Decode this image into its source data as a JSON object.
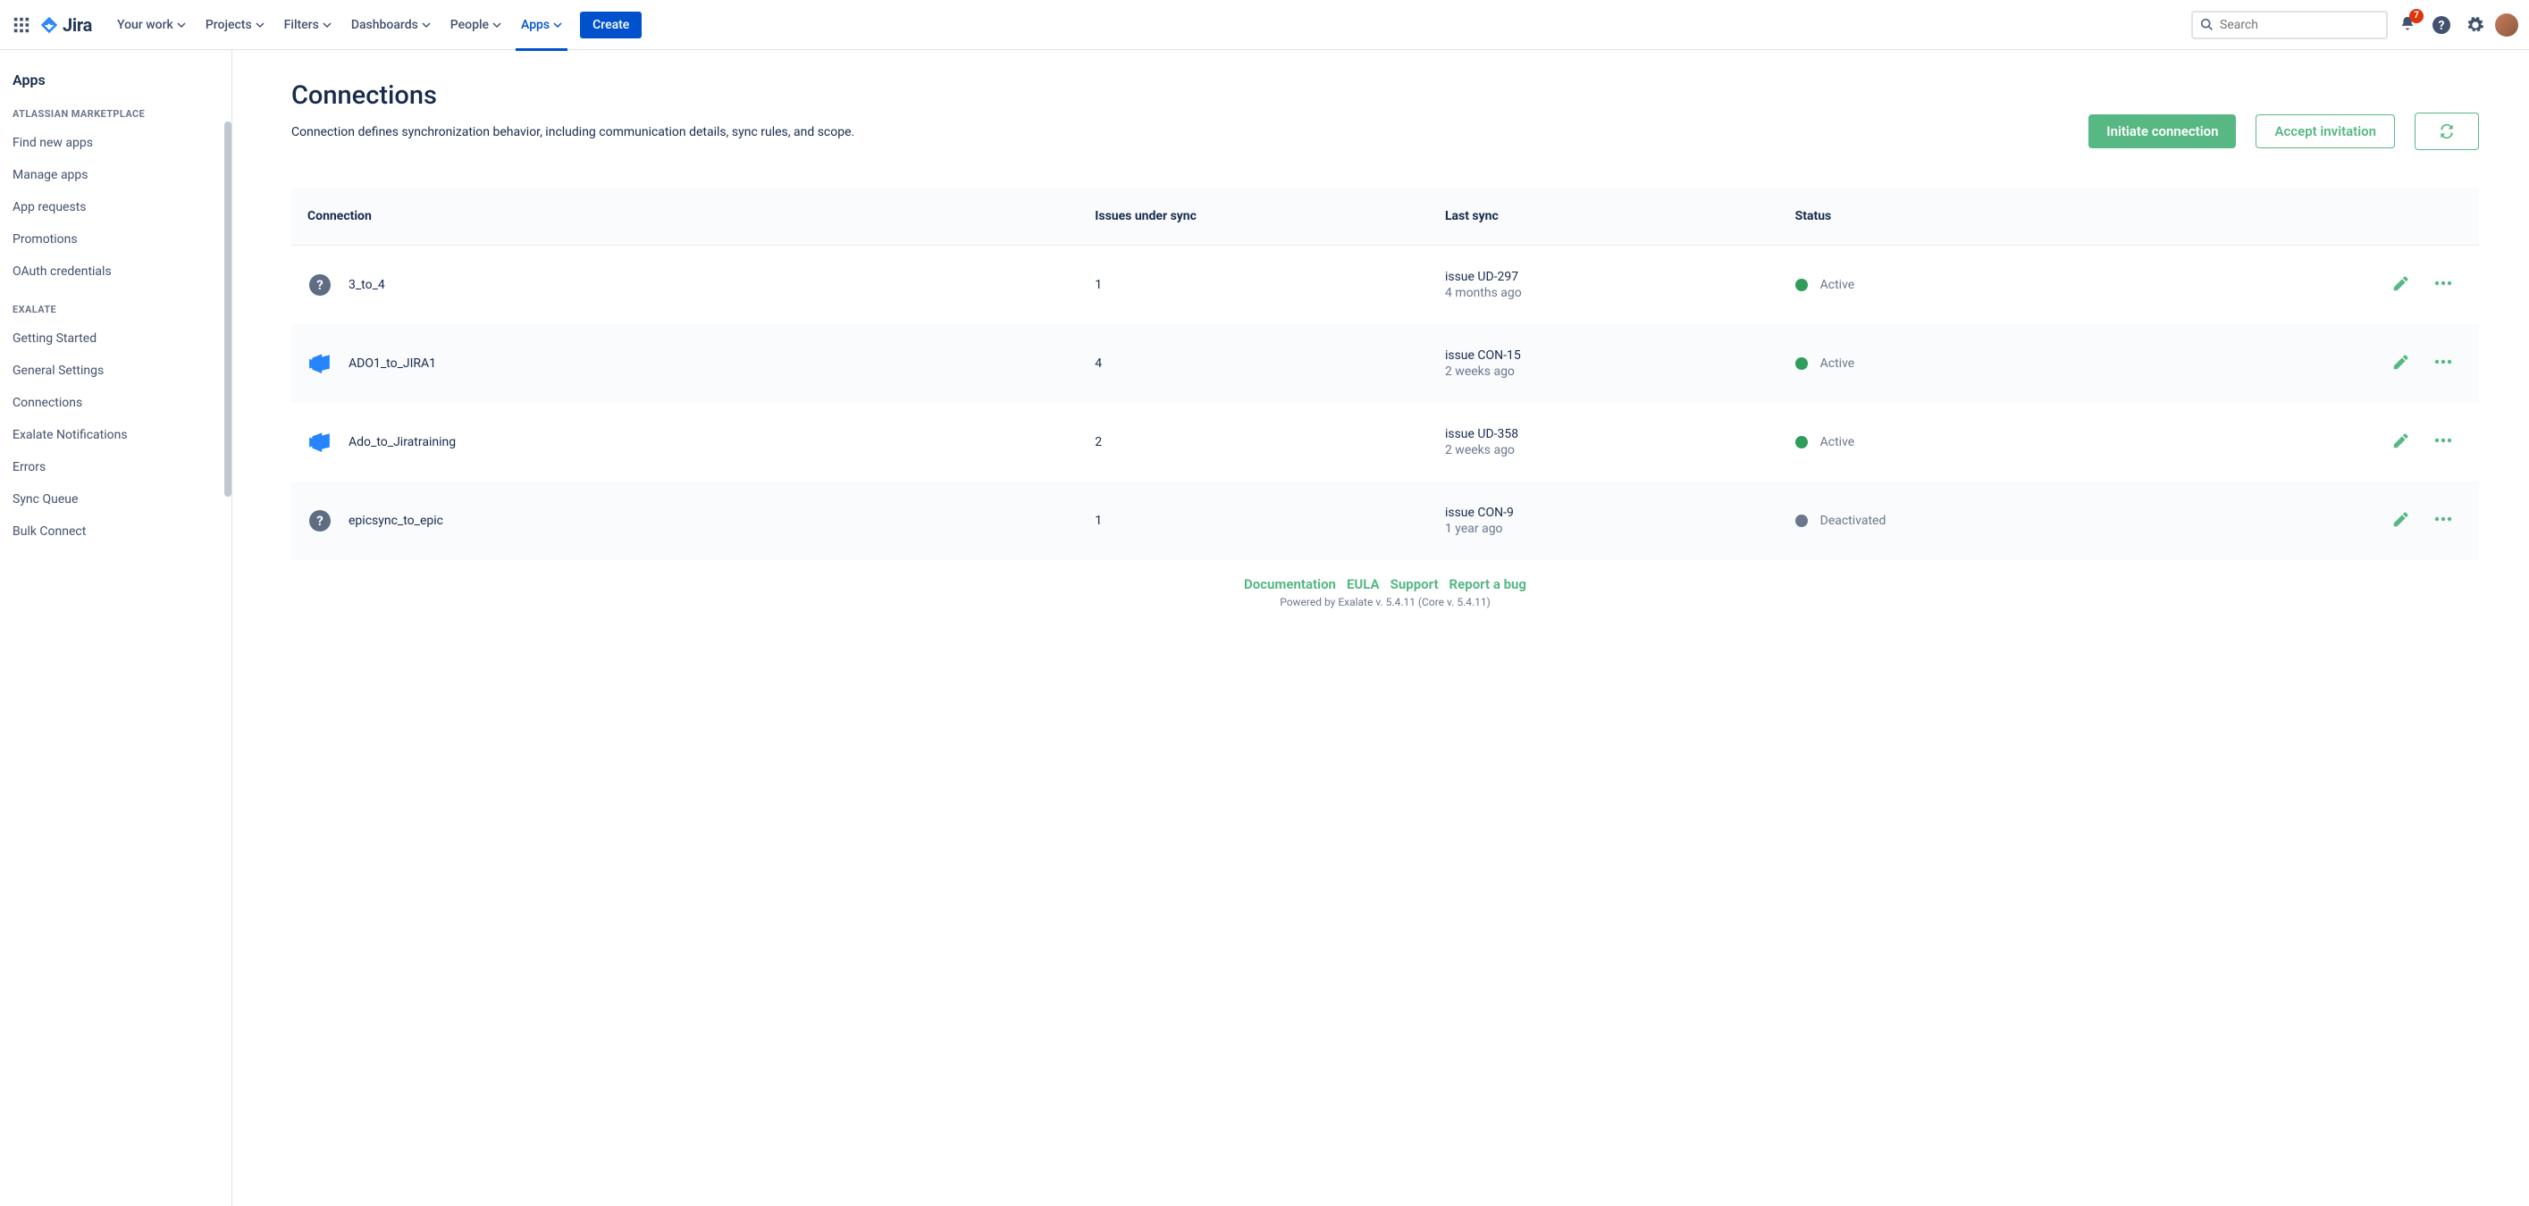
{
  "nav": {
    "product": "Jira",
    "items": [
      "Your work",
      "Projects",
      "Filters",
      "Dashboards",
      "People",
      "Apps"
    ],
    "active_index": 5,
    "create": "Create",
    "search_placeholder": "Search",
    "notif_count": "7"
  },
  "sidebar": {
    "title": "Apps",
    "sections": [
      {
        "label": "ATLASSIAN MARKETPLACE",
        "items": [
          "Find new apps",
          "Manage apps",
          "App requests",
          "Promotions",
          "OAuth credentials"
        ]
      },
      {
        "label": "EXALATE",
        "items": [
          "Getting Started",
          "General Settings",
          "Connections",
          "Exalate Notifications",
          "Errors",
          "Sync Queue",
          "Bulk Connect"
        ]
      }
    ]
  },
  "page": {
    "title": "Connections",
    "description": "Connection defines synchronization behavior, including communication details, sync rules, and scope.",
    "initiate_btn": "Initiate connection",
    "accept_btn": "Accept invitation"
  },
  "table": {
    "headers": [
      "Connection",
      "Issues under sync",
      "Last sync",
      "Status",
      ""
    ],
    "rows": [
      {
        "icon": "question",
        "name": "3_to_4",
        "issues": "1",
        "sync1": "issue UD-297",
        "sync2": "4 months ago",
        "status": "Active",
        "status_color": "green"
      },
      {
        "icon": "ado",
        "name": "ADO1_to_JIRA1",
        "issues": "4",
        "sync1": "issue CON-15",
        "sync2": "2 weeks ago",
        "status": "Active",
        "status_color": "green"
      },
      {
        "icon": "ado",
        "name": "Ado_to_Jiratraining",
        "issues": "2",
        "sync1": "issue UD-358",
        "sync2": "2 weeks ago",
        "status": "Active",
        "status_color": "green"
      },
      {
        "icon": "question",
        "name": "epicsync_to_epic",
        "issues": "1",
        "sync1": "issue CON-9",
        "sync2": "1 year ago",
        "status": "Deactivated",
        "status_color": "grey"
      }
    ]
  },
  "footer": {
    "links": [
      "Documentation",
      "EULA",
      "Support",
      "Report a bug"
    ],
    "sub": "Powered by Exalate v. 5.4.11 (Core v. 5.4.11)"
  }
}
